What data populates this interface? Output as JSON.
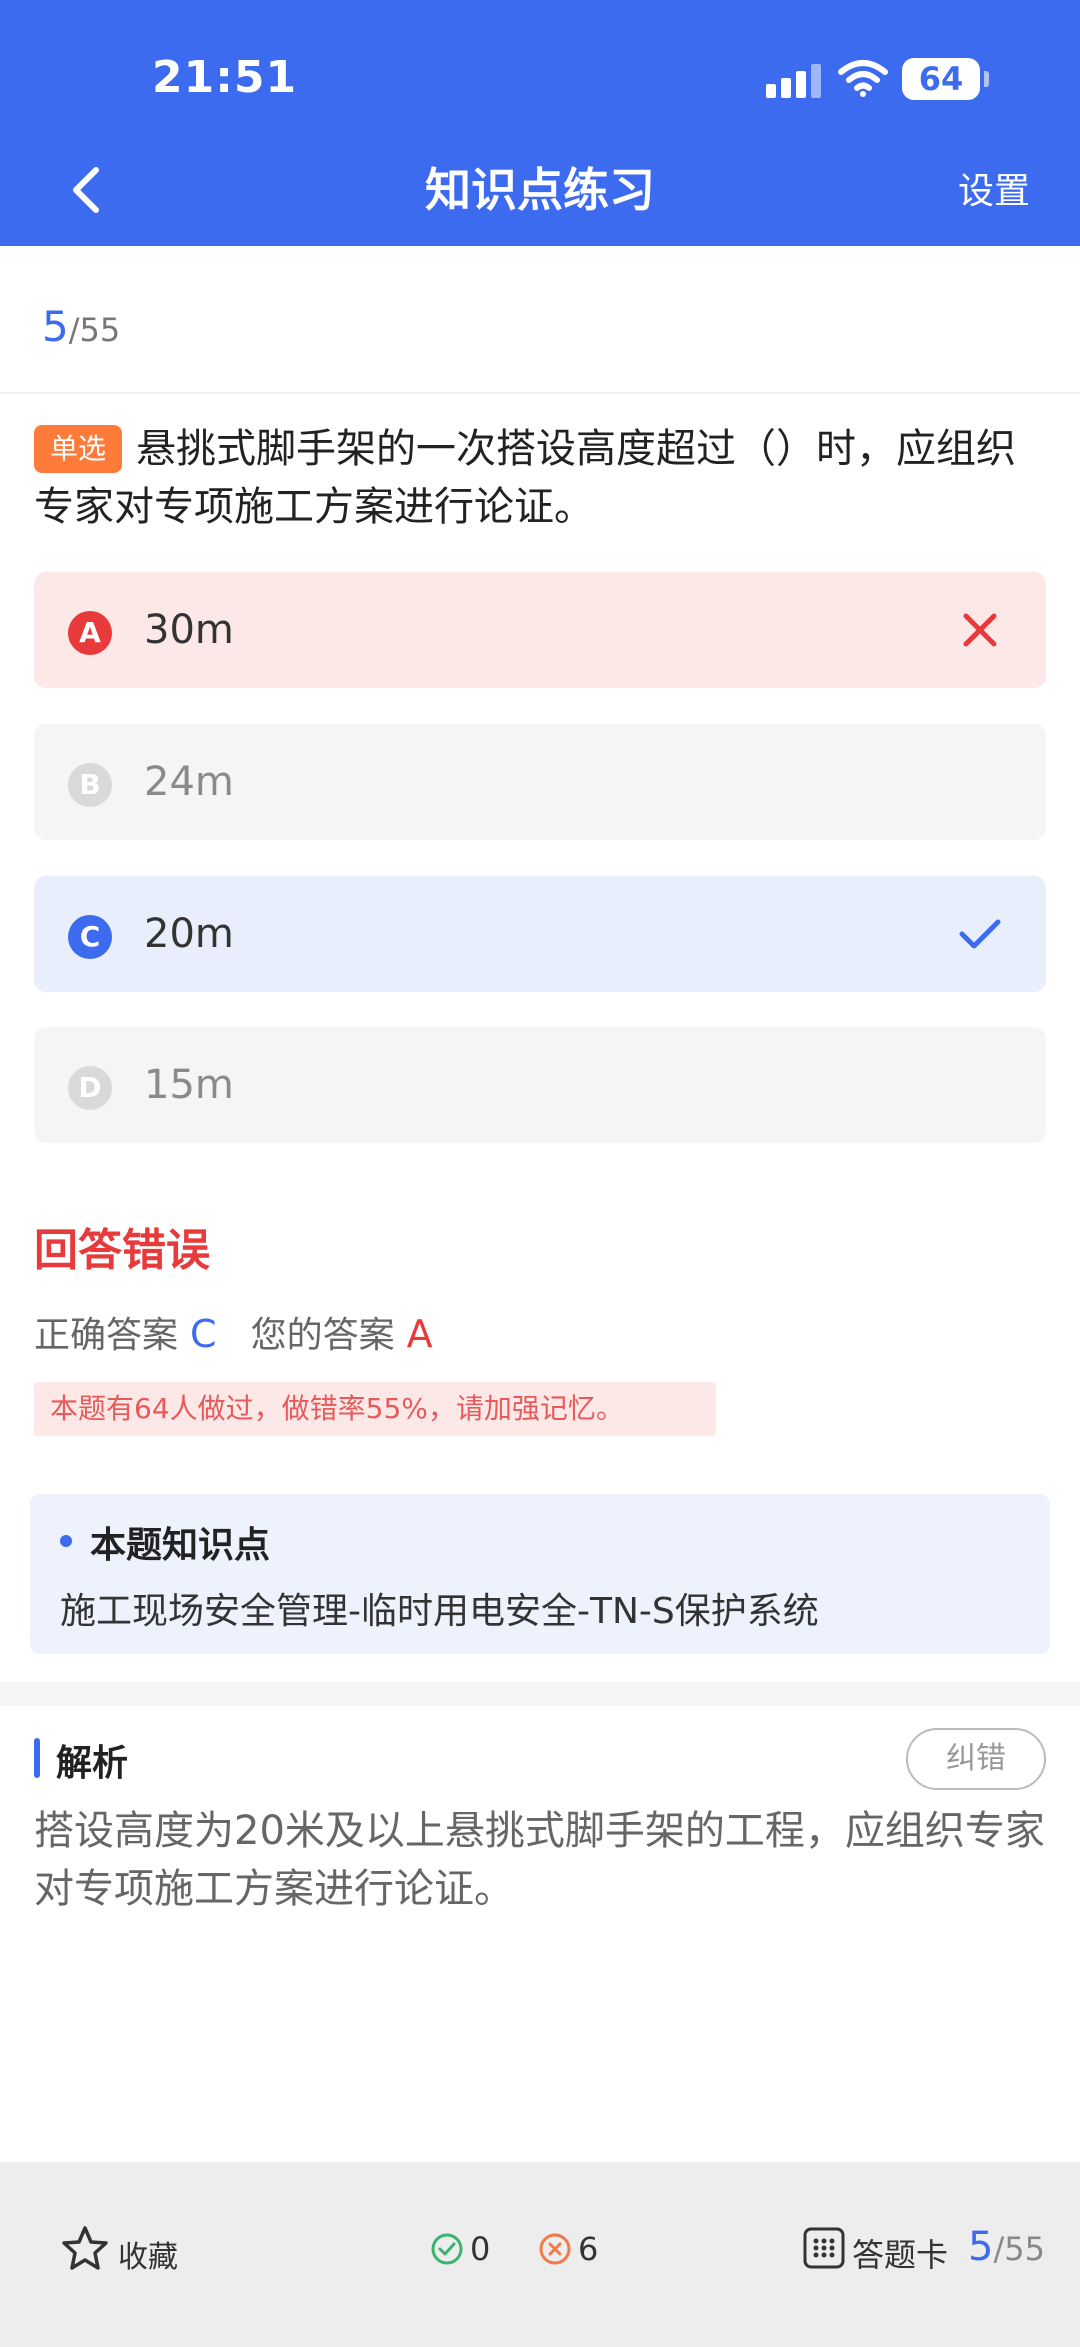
{
  "status_bar": {
    "time": "21:51",
    "battery": "64"
  },
  "nav": {
    "title": "知识点练习",
    "settings_label": "设置"
  },
  "progress": {
    "current": "5",
    "total": "/55"
  },
  "question": {
    "type_badge": "单选",
    "text": "悬挑式脚手架的一次搭设高度超过（）时，应组织专家对专项施工方案进行论证。"
  },
  "options": [
    {
      "letter": "A",
      "text": "30m",
      "state": "wrong"
    },
    {
      "letter": "B",
      "text": "24m",
      "state": "neutral"
    },
    {
      "letter": "C",
      "text": "20m",
      "state": "correct"
    },
    {
      "letter": "D",
      "text": "15m",
      "state": "neutral"
    }
  ],
  "result": {
    "title": "回答错误",
    "correct_label": "正确答案",
    "correct_value": "C",
    "your_label": "您的答案",
    "your_value": "A",
    "stat_note": "本题有64人做过，做错率55%，请加强记忆。"
  },
  "knowledge_point": {
    "title": "本题知识点",
    "text": "施工现场安全管理-临时用电安全-TN-S保护系统"
  },
  "analysis": {
    "title": "解析",
    "report_label": "纠错",
    "text": "搭设高度为20米及以上悬挑式脚手架的工程，应组织专家对专项施工方案进行论证。"
  },
  "bottom_bar": {
    "favorite_label": "收藏",
    "correct_count": "0",
    "wrong_count": "6",
    "answer_card_label": "答题卡",
    "progress_current": "5",
    "progress_total": "/55"
  },
  "colors": {
    "primary": "#3d6bf0",
    "error": "#e83a3a",
    "badge": "#ff7b3a"
  }
}
